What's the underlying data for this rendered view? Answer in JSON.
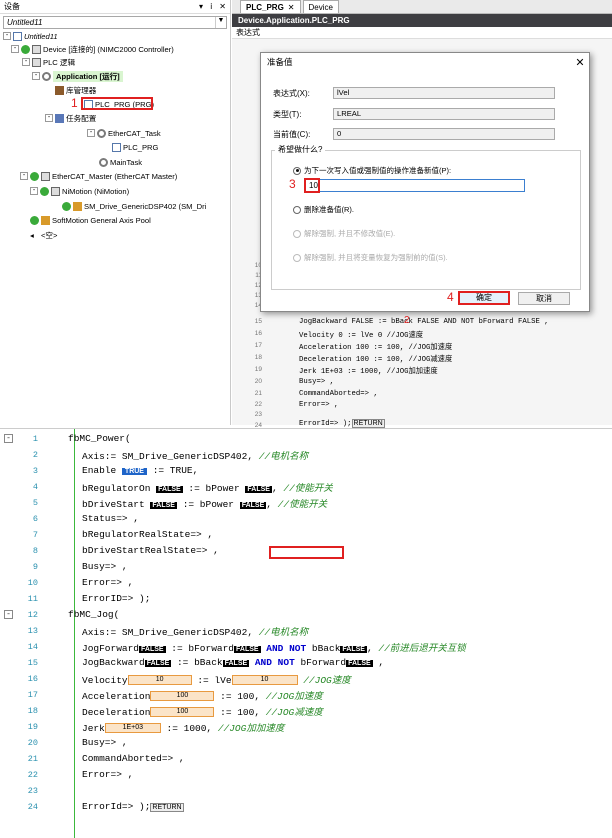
{
  "devices": {
    "title": "设备",
    "title_buttons": [
      "▾",
      "ⅰ",
      "✕"
    ],
    "combo": "Untitled11",
    "items": [
      {
        "label": "Untitled11",
        "level": 0,
        "icon": "project-icon"
      },
      {
        "label": "Device [连接的] (NIMC2000 Controller)",
        "level": 1,
        "icon": "device-icon"
      },
      {
        "label": "PLC 逻辑",
        "level": 2,
        "icon": "plc-logic-icon"
      },
      {
        "label": "Application [运行]",
        "level": 3,
        "icon": "application-icon"
      },
      {
        "label": "库管理器",
        "level": 4,
        "icon": "library-icon"
      },
      {
        "label": "PLC_PRG (PRG)",
        "level": 4,
        "icon": "pou-icon"
      },
      {
        "label": "任务配置",
        "level": 4,
        "icon": "task-config-icon"
      },
      {
        "label": "EtherCAT_Task",
        "level": 5,
        "icon": "task-icon"
      },
      {
        "label": "PLC_PRG",
        "level": 6,
        "icon": "pou-icon"
      },
      {
        "label": "MainTask",
        "level": 5,
        "icon": "task-icon"
      },
      {
        "label": "EtherCAT_Master (EtherCAT Master)",
        "level": 2,
        "icon": "ethercat-icon"
      },
      {
        "label": "NiMotion (NiMotion)",
        "level": 3,
        "icon": "nimotion-icon"
      },
      {
        "label": "SM_Drive_GenericDSP402 (SM_Dri",
        "level": 4,
        "icon": "axis-icon"
      },
      {
        "label": "SoftMotion General Axis Pool",
        "level": 2,
        "icon": "axis-pool-icon"
      },
      {
        "label": "<空>",
        "level": 1,
        "icon": "empty-icon"
      }
    ],
    "marker1": "1"
  },
  "editor": {
    "tabs": [
      {
        "label": "PLC_PRG",
        "close": "✕"
      },
      {
        "label": "Device"
      }
    ],
    "path": "Device.Application.PLC_PRG",
    "watch_header": "表达式"
  },
  "dialog": {
    "title": "准备值",
    "close": "✕",
    "expr_label": "表达式(X):",
    "expr_value": "lVel",
    "type_label": "类型(T):",
    "type_value": "LREAL",
    "cur_label": "当前值(C):",
    "cur_value": "0",
    "group_label": "希望做什么?",
    "opt1": "为下一次写入值或强制值的操作准备新值(P):",
    "input_value": "10",
    "opt2": "删除准备值(R).",
    "opt3": "解除强制, 并且不修改值(E).",
    "opt4": "解除强制, 并且将变量恢复为强制前的值(S).",
    "ok": "确定",
    "cancel": "取消",
    "marker2": "2",
    "marker3": "3",
    "marker4": "4"
  },
  "mini_code": {
    "lines": [
      {
        "n": "10",
        "text": ""
      },
      {
        "n": "11",
        "text": ""
      },
      {
        "n": "12",
        "text": ""
      },
      {
        "n": "13",
        "text": ""
      },
      {
        "n": "14",
        "text": ""
      },
      {
        "n": "15",
        "text": "JogBackward FALSE := bBack FALSE AND NOT bForward FALSE ,"
      },
      {
        "n": "16",
        "text": "Velocity 0 := lVe 0 //JOG速度"
      },
      {
        "n": "17",
        "text": "Acceleration 100 := 100, //JOG加速度"
      },
      {
        "n": "18",
        "text": "Deceleration 100 := 100, //JOG减速度"
      },
      {
        "n": "19",
        "text": "Jerk 1E+03 := 1000, //JOG加加速度"
      },
      {
        "n": "20",
        "text": "Busy=> ,"
      },
      {
        "n": "21",
        "text": "CommandAborted=> ,"
      },
      {
        "n": "22",
        "text": "Error=> ,"
      },
      {
        "n": "23",
        "text": ""
      },
      {
        "n": "24",
        "text": "ErrorId=> );"
      }
    ],
    "return_label": "RETURN"
  },
  "code": {
    "false": "FALSE",
    "true": "TRUE",
    "ret": "RETURN",
    "l1": "fbMC_Power(",
    "l2a": "Axis:= SM_Drive_GenericDSP402, ",
    "l2c": "//电机名称",
    "l3a": "Enable",
    "l3b": ":= TRUE,",
    "l4a": "bRegulatorOn",
    "l4b": ":= bPower",
    "l4c": ", ",
    "l4d": "//使能开关",
    "l5a": "bDriveStart",
    "l5b": ":= bPower",
    "l5c": ", ",
    "l5d": "//使能开关",
    "l6": "Status=> ,",
    "l7": "bRegulatorRealState=> ,",
    "l8": "bDriveStartRealState=> ,",
    "l9": "Busy=> ,",
    "l10": "Error=> ,",
    "l11": "ErrorID=> );",
    "l12": "fbMC_Jog(",
    "l13a": "Axis:= SM_Drive_GenericDSP402,  ",
    "l13c": "//电机名称",
    "l14a": "JogForward",
    "l14b": ":= bForward",
    "l14k": "AND NOT",
    "l14d": "bBack",
    "l14e": ", ",
    "l14f": "//前进后退开关互锁",
    "l15a": "JogBackward",
    "l15b": ":= bBack",
    "l15k": "AND NOT",
    "l15d": "bForward",
    "l15e": " ,",
    "l16a": "Velocity",
    "l16v": "10",
    "l16b": ":= lVe",
    "l16v2": "10",
    "l16c": " //JOG速度",
    "l17a": "Acceleration",
    "l17v": "100",
    "l17b": ":= 100, ",
    "l17c": "//JOG加速度",
    "l18a": "Deceleration",
    "l18v": "100",
    "l18b": ":= 100, ",
    "l18c": "//JOG减速度",
    "l19a": "Jerk",
    "l19v": "1E+03",
    "l19b": ":= 1000, ",
    "l19c": "//JOG加加速度",
    "l20": "Busy=> ,",
    "l21": "CommandAborted=> ,",
    "l22": "Error=> ,",
    "l24": "ErrorId=> );"
  }
}
